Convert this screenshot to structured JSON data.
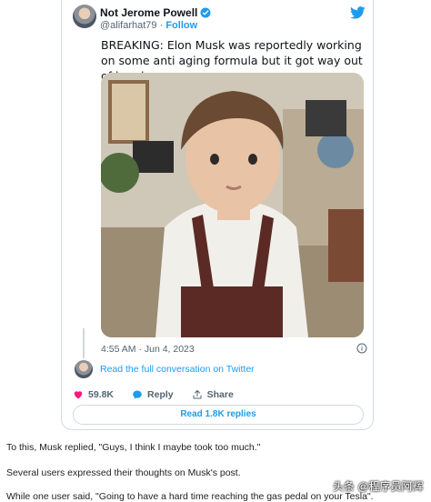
{
  "tweet": {
    "author": "Not Jerome Powell",
    "handle": "@alifarhat79",
    "dot": " · ",
    "follow": "Follow",
    "text": "BREAKING: Elon Musk was reportedly working on some anti aging formula but it got way out of hand",
    "timestamp": "4:55 AM · Jun 4, 2023",
    "conversation_link": "Read the full conversation on Twitter",
    "likes": "59.8K",
    "reply_label": "Reply",
    "share_label": "Share",
    "read_replies": "Read 1.8K replies"
  },
  "colors": {
    "accent": "#1d9bf0",
    "like": "#f91880",
    "muted": "#536471"
  },
  "icons": [
    "verified-icon",
    "twitter-icon",
    "info-icon",
    "heart-icon",
    "reply-icon",
    "share-icon"
  ],
  "article": {
    "p1": "To this, Musk replied, \"Guys, I think I maybe took too much.\"",
    "p2": "Several users expressed their thoughts on Musk's post.",
    "p3": "While one user said, \"Going to have a hard time reaching the gas pedal on your Tesla\"."
  },
  "watermark": "头条 @程序员阿辉"
}
